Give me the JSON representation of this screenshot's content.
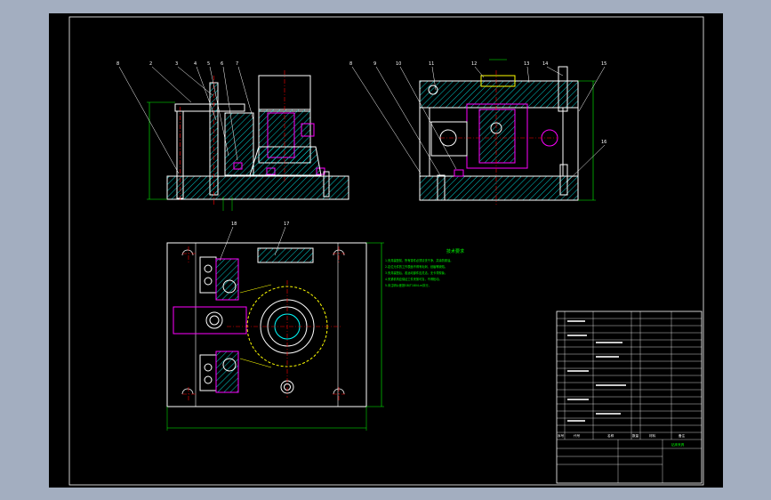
{
  "callouts": {
    "front": [
      "8",
      "2",
      "3",
      "4",
      "5",
      "6",
      "7"
    ],
    "side": [
      "8",
      "9",
      "10",
      "11",
      "12",
      "13",
      "14",
      "15",
      "16"
    ],
    "top": [
      "18",
      "17"
    ]
  },
  "technical_requirements": {
    "title": "技术要求",
    "lines": [
      "1.夹具装配前，所有零件必须清洗干净，并涂防锈油。",
      "2.定位元件的工作表面不得有毛刺、划痕等缺陷。",
      "3.夹具装配后，各运动部件应灵活，无卡滞现象。",
      "4.夹紧机构应保证工件夹紧可靠，不得松动。",
      "5.未注明公差按GB/T1804-m执行。"
    ]
  },
  "title_block": {
    "drawing_name": "钻床夹具",
    "header_row": [
      "序号",
      "代号",
      "名称",
      "数量",
      "材料",
      "备注"
    ]
  },
  "colors": {
    "outline": "#ffffff",
    "hidden": "#ff00ff",
    "hatch": "#00ffff",
    "center": "#ff0000",
    "dimension": "#00ff00",
    "aux": "#ffff00"
  }
}
